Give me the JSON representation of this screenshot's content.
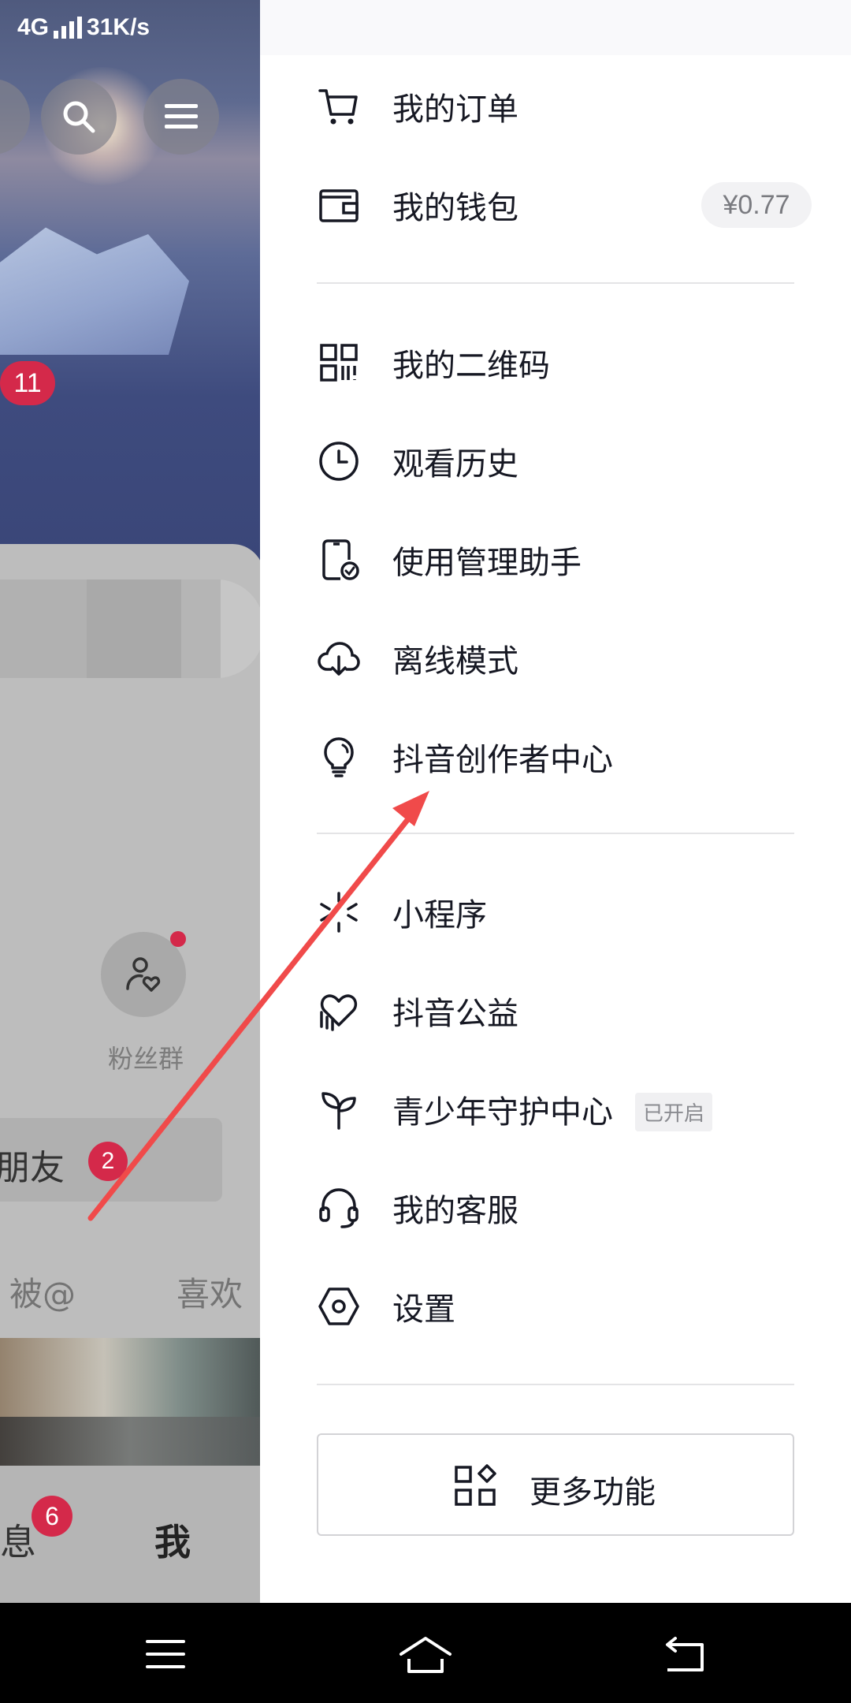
{
  "status_bar": {
    "network": "4G",
    "speed": "31K/s"
  },
  "left_page": {
    "notification_badge": "11",
    "fans_label": "粉丝群",
    "friend_text": "加朋友",
    "friend_badge": "2",
    "tabs": [
      "被@",
      "喜欢"
    ],
    "bottom_nav": {
      "messages_label": "消息",
      "messages_badge": "6",
      "me_label": "我"
    }
  },
  "drawer": {
    "menu_group1": [
      {
        "label": "我的订单",
        "icon": "cart-icon"
      },
      {
        "label": "我的钱包",
        "icon": "wallet-icon",
        "value": "¥0.77"
      }
    ],
    "menu_group2": [
      {
        "label": "我的二维码",
        "icon": "qr-code-icon"
      },
      {
        "label": "观看历史",
        "icon": "clock-icon"
      },
      {
        "label": "使用管理助手",
        "icon": "phone-check-icon"
      },
      {
        "label": "离线模式",
        "icon": "cloud-download-icon"
      },
      {
        "label": "抖音创作者中心",
        "icon": "lightbulb-icon"
      }
    ],
    "menu_group3": [
      {
        "label": "小程序",
        "icon": "mini-program-icon"
      },
      {
        "label": "抖音公益",
        "icon": "heart-hand-icon"
      },
      {
        "label": "青少年守护中心",
        "icon": "sprout-icon",
        "tag": "已开启"
      },
      {
        "label": "我的客服",
        "icon": "headset-icon"
      },
      {
        "label": "设置",
        "icon": "hexagon-settings-icon"
      }
    ],
    "more_button": "更多功能"
  },
  "colors": {
    "accent_red": "#d4294a",
    "annotation_arrow": "#f04a4a",
    "text_primary": "#161823"
  }
}
